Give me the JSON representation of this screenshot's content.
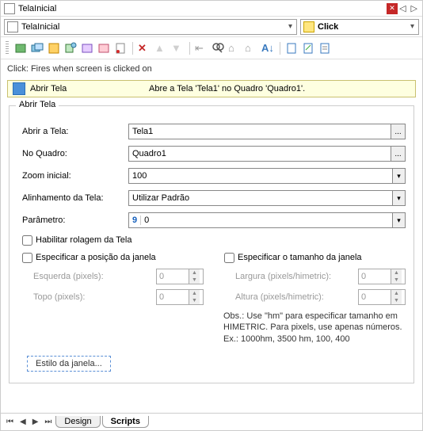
{
  "title": "TelaInicial",
  "left_combo": "TelaInicial",
  "right_combo": "Click",
  "event_desc": "Click: Fires when screen is clicked on",
  "action": {
    "name": "Abrir Tela",
    "desc": "Abre a Tela 'Tela1' no Quadro 'Quadro1'."
  },
  "group": {
    "legend": "Abrir Tela",
    "rows": {
      "abrir_tela": {
        "label": "Abrir a Tela:",
        "value": "Tela1"
      },
      "no_quadro": {
        "label": "No Quadro:",
        "value": "Quadro1"
      },
      "zoom": {
        "label": "Zoom inicial:",
        "value": "100"
      },
      "alinhamento": {
        "label": "Alinhamento da Tela:",
        "value": "Utilizar Padrão"
      },
      "parametro": {
        "label": "Parâmetro:",
        "prefix": "9",
        "value": "0"
      }
    },
    "check_rolagem": "Habilitar rolagem da Tela",
    "check_pos": "Especificar a posição da janela",
    "check_tam": "Especificar o tamanho da janela",
    "subfields": {
      "esquerda": {
        "label": "Esquerda (pixels):",
        "value": "0"
      },
      "topo": {
        "label": "Topo (pixels):",
        "value": "0"
      },
      "largura": {
        "label": "Largura (pixels/himetric):",
        "value": "0"
      },
      "altura": {
        "label": "Altura (pixels/himetric):",
        "value": "0"
      }
    },
    "note": "Obs.: Use \"hm\" para especificar tamanho em HIMETRIC. Para pixels, use apenas números. Ex.: 1000hm, 3500 hm, 100, 400",
    "style_button": "Estilo da janela..."
  },
  "tabs": {
    "design": "Design",
    "scripts": "Scripts"
  }
}
